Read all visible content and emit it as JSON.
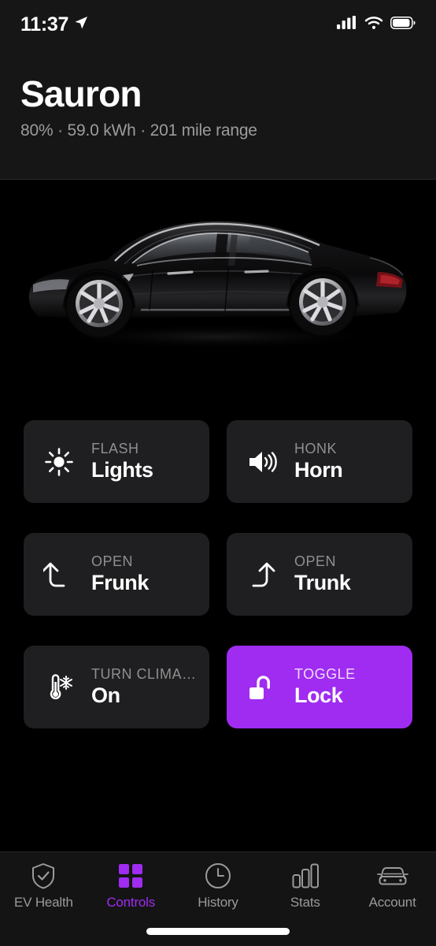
{
  "status_bar": {
    "time": "11:37",
    "location_icon": "location-arrow-icon",
    "cellular_icon": "cellular-signal-icon",
    "wifi_icon": "wifi-icon",
    "battery_icon": "battery-icon"
  },
  "header": {
    "car_name": "Sauron",
    "stats": "80% · 59.0 kWh · 201 mile range",
    "battery_percent": "80%",
    "energy": "59.0 kWh",
    "range": "201 mile range"
  },
  "hero": {
    "vehicle_image": "tesla-model-s-side-profile-black"
  },
  "controls": [
    {
      "kicker": "FLASH",
      "title": "Lights",
      "icon": "sun-icon",
      "name": "lights",
      "active": false
    },
    {
      "kicker": "HONK",
      "title": "Horn",
      "icon": "speaker-waves-icon",
      "name": "horn",
      "active": false
    },
    {
      "kicker": "OPEN",
      "title": "Frunk",
      "icon": "arrow-hook-up-left-icon",
      "name": "frunk",
      "active": false
    },
    {
      "kicker": "OPEN",
      "title": "Trunk",
      "icon": "arrow-hook-up-right-icon",
      "name": "trunk",
      "active": false
    },
    {
      "kicker": "TURN CLIMA…",
      "title": "On",
      "icon": "thermometer-snowflake-icon",
      "name": "climate",
      "active": false
    },
    {
      "kicker": "TOGGLE",
      "title": "Lock",
      "icon": "padlock-open-icon",
      "name": "lock",
      "active": true
    }
  ],
  "tabs": [
    {
      "label": "EV Health",
      "icon": "shield-check-icon",
      "active": false
    },
    {
      "label": "Controls",
      "icon": "grid-squares-icon",
      "active": true
    },
    {
      "label": "History",
      "icon": "clock-icon",
      "active": false
    },
    {
      "label": "Stats",
      "icon": "bar-chart-icon",
      "active": false
    },
    {
      "label": "Account",
      "icon": "car-front-icon",
      "active": false
    }
  ],
  "colors": {
    "accent": "#9f2cf0",
    "background": "#000000",
    "card": "#1f1f21",
    "header": "#161616",
    "muted_text": "#9a9a9a"
  }
}
